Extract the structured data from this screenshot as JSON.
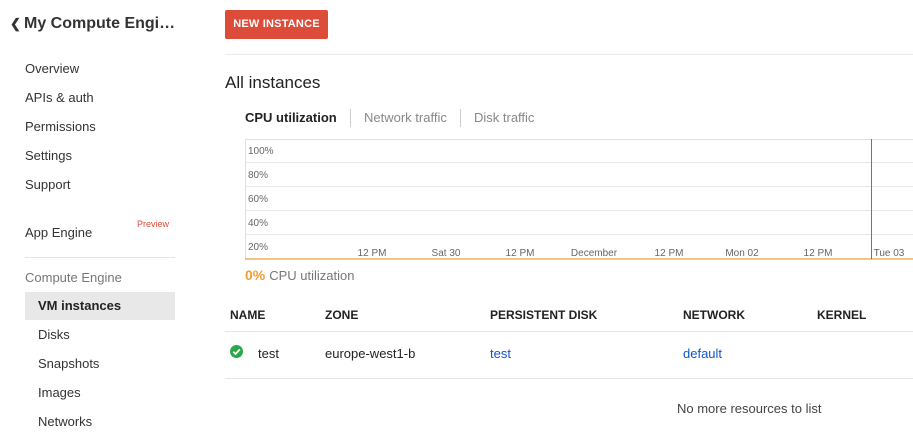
{
  "sidebar": {
    "project_title": "My Compute Engi…",
    "items": [
      {
        "label": "Overview"
      },
      {
        "label": "APIs & auth"
      },
      {
        "label": "Permissions"
      },
      {
        "label": "Settings"
      },
      {
        "label": "Support"
      }
    ],
    "app_engine": {
      "label": "App Engine",
      "badge": "Preview"
    },
    "compute_engine": {
      "label": "Compute Engine",
      "items": [
        {
          "label": "VM instances",
          "active": true
        },
        {
          "label": "Disks"
        },
        {
          "label": "Snapshots"
        },
        {
          "label": "Images"
        },
        {
          "label": "Networks"
        }
      ]
    }
  },
  "toolbar": {
    "new_instance_label": "NEW INSTANCE"
  },
  "main": {
    "heading": "All instances",
    "tabs": [
      {
        "label": "CPU utilization",
        "active": true
      },
      {
        "label": "Network traffic"
      },
      {
        "label": "Disk traffic"
      }
    ],
    "utilization": {
      "value": "0%",
      "label": "CPU utilization"
    }
  },
  "chart_data": {
    "type": "line",
    "y_ticks": [
      "100%",
      "80%",
      "60%",
      "40%",
      "20%"
    ],
    "x_ticks": [
      "12 PM",
      "Sat 30",
      "12 PM",
      "December",
      "12 PM",
      "Mon 02",
      "12 PM",
      "Tue 03"
    ],
    "series": [
      {
        "values": [
          0,
          0,
          0,
          0,
          0,
          0,
          0,
          0
        ]
      }
    ],
    "ylim": [
      0,
      100
    ],
    "grid": true,
    "marker_color": "#dd4b39"
  },
  "table": {
    "columns": [
      "NAME",
      "ZONE",
      "PERSISTENT DISK",
      "NETWORK",
      "KERNEL"
    ],
    "rows": [
      {
        "status": "running",
        "name": "test",
        "zone": "europe-west1-b",
        "disk": "test",
        "network": "default",
        "kernel": ""
      }
    ],
    "footer": "No more resources to list"
  },
  "colors": {
    "accent": "#dd4b39",
    "link": "#1155cc",
    "util": "#f39c31",
    "status_ok": "#2aa84a"
  }
}
